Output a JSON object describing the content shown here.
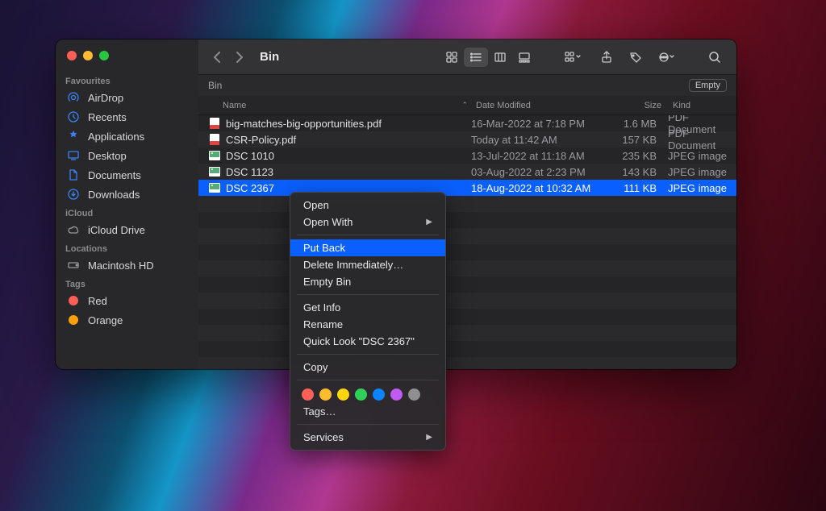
{
  "window": {
    "title": "Bin",
    "path_label": "Bin",
    "empty_button": "Empty"
  },
  "sidebar": {
    "sections": [
      {
        "label": "Favourites",
        "items": [
          {
            "icon": "airdrop",
            "label": "AirDrop"
          },
          {
            "icon": "clock",
            "label": "Recents"
          },
          {
            "icon": "apps",
            "label": "Applications"
          },
          {
            "icon": "desktop",
            "label": "Desktop"
          },
          {
            "icon": "doc",
            "label": "Documents"
          },
          {
            "icon": "download",
            "label": "Downloads"
          }
        ]
      },
      {
        "label": "iCloud",
        "items": [
          {
            "icon": "cloud",
            "label": "iCloud Drive"
          }
        ]
      },
      {
        "label": "Locations",
        "items": [
          {
            "icon": "disk",
            "label": "Macintosh HD"
          }
        ]
      },
      {
        "label": "Tags",
        "items": [
          {
            "icon": "tag",
            "color": "#ff5f57",
            "label": "Red"
          },
          {
            "icon": "tag",
            "color": "#ff9f0a",
            "label": "Orange"
          }
        ]
      }
    ]
  },
  "columns": {
    "name": "Name",
    "date": "Date Modified",
    "size": "Size",
    "kind": "Kind"
  },
  "rows": [
    {
      "icon": "pdf",
      "name": "big-matches-big-opportunities.pdf",
      "date": "16-Mar-2022 at 7:18 PM",
      "size": "1.6 MB",
      "kind": "PDF Document",
      "selected": false
    },
    {
      "icon": "pdf",
      "name": "CSR-Policy.pdf",
      "date": "Today at 11:42 AM",
      "size": "157 KB",
      "kind": "PDF Document",
      "selected": false
    },
    {
      "icon": "jpeg",
      "name": "DSC 1010",
      "date": "13-Jul-2022 at 11:18 AM",
      "size": "235 KB",
      "kind": "JPEG image",
      "selected": false
    },
    {
      "icon": "jpeg",
      "name": "DSC 1123",
      "date": "03-Aug-2022 at 2:23 PM",
      "size": "143 KB",
      "kind": "JPEG image",
      "selected": false
    },
    {
      "icon": "jpeg",
      "name": "DSC 2367",
      "date": "18-Aug-2022 at 10:32 AM",
      "size": "111 KB",
      "kind": "JPEG image",
      "selected": true
    }
  ],
  "context_menu": {
    "items": [
      {
        "label": "Open"
      },
      {
        "label": "Open With",
        "submenu": true
      },
      {
        "sep": true
      },
      {
        "label": "Put Back",
        "hover": true
      },
      {
        "label": "Delete Immediately…"
      },
      {
        "label": "Empty Bin"
      },
      {
        "sep": true
      },
      {
        "label": "Get Info"
      },
      {
        "label": "Rename"
      },
      {
        "label": "Quick Look \"DSC 2367\""
      },
      {
        "sep": true
      },
      {
        "label": "Copy"
      },
      {
        "sep": true
      },
      {
        "tags": true,
        "colors": [
          "#ff6159",
          "#ffbd2e",
          "#ffd60a",
          "#30d158",
          "#0a84ff",
          "#bf5af2",
          "#8e8e93"
        ]
      },
      {
        "label": "Tags…"
      },
      {
        "sep": true
      },
      {
        "label": "Services",
        "submenu": true
      }
    ]
  }
}
